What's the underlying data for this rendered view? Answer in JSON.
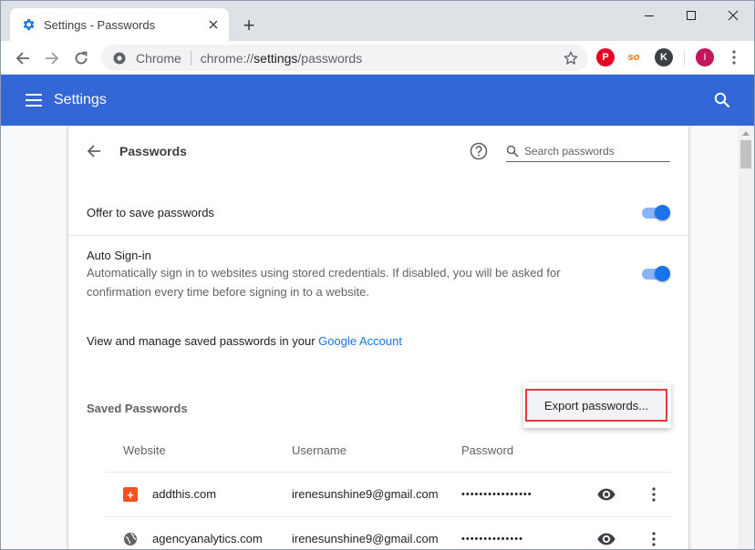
{
  "browser": {
    "tab_title": "Settings - Passwords",
    "new_tab_symbol": "+",
    "omnibox": {
      "chip": "Chrome",
      "url_scheme": "chrome://",
      "url_host": "settings",
      "url_path": "/passwords"
    },
    "extensions": [
      {
        "name": "pinterest-icon",
        "label": "P"
      },
      {
        "name": "so-extension-icon",
        "label": "so"
      },
      {
        "name": "k-extension-icon",
        "label": "K"
      }
    ],
    "avatar_initial": "I"
  },
  "header": {
    "title": "Settings"
  },
  "passwords_page": {
    "title": "Passwords",
    "search_placeholder": "Search passwords",
    "offer_to_save": {
      "label": "Offer to save passwords",
      "enabled": true
    },
    "auto_signin": {
      "label": "Auto Sign-in",
      "description": "Automatically sign in to websites using stored credentials. If disabled, you will be asked for confirmation every time before signing in to a website.",
      "enabled": true
    },
    "manage": {
      "text": "View and manage saved passwords in your ",
      "link": "Google Account"
    },
    "saved_passwords_heading": "Saved Passwords",
    "export_menu_item": "Export passwords...",
    "columns": {
      "website": "Website",
      "username": "Username",
      "password": "Password"
    },
    "entries": [
      {
        "website": "addthis.com",
        "username": "irenesunshine9@gmail.com",
        "password": "••••••••••••••••",
        "favicon_color": "#f4511e"
      },
      {
        "website": "agencyanalytics.com",
        "username": "irenesunshine9@gmail.com",
        "password": "••••••••••••••",
        "favicon_color": "#5f6368"
      }
    ]
  },
  "colors": {
    "header_blue": "#3367d6",
    "toggle_blue": "#1a73e8",
    "link_blue": "#1a73e8",
    "highlight_red": "#e0393e"
  }
}
